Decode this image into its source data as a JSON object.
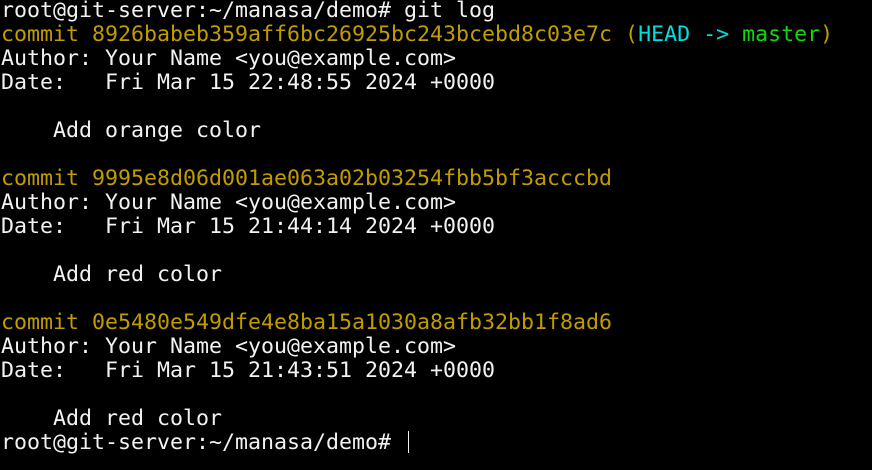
{
  "prompt": "root@git-server:~/manasa/demo# ",
  "command": "git log",
  "colors": {
    "hash": "#c19c00",
    "head": "#00dede",
    "branch": "#13d613",
    "text": "#f2f2f2",
    "background": "#000000"
  },
  "commits": [
    {
      "commit_label": "commit ",
      "hash": "8926babeb359aff6bc26925bc243bcebd8c03e7c",
      "refs": {
        "open": " (",
        "head": "HEAD -> ",
        "branch": "master",
        "close": ")"
      },
      "author": "Author: Your Name <you@example.com>",
      "date": "Date:   Fri Mar 15 22:48:55 2024 +0000",
      "message": "    Add orange color"
    },
    {
      "commit_label": "commit ",
      "hash": "9995e8d06d001ae063a02b03254fbb5bf3acccbd",
      "author": "Author: Your Name <you@example.com>",
      "date": "Date:   Fri Mar 15 21:44:14 2024 +0000",
      "message": "    Add red color"
    },
    {
      "commit_label": "commit ",
      "hash": "0e5480e549dfe4e8ba15a1030a8afb32bb1f8ad6",
      "author": "Author: Your Name <you@example.com>",
      "date": "Date:   Fri Mar 15 21:43:51 2024 +0000",
      "message": "    Add red color"
    }
  ]
}
